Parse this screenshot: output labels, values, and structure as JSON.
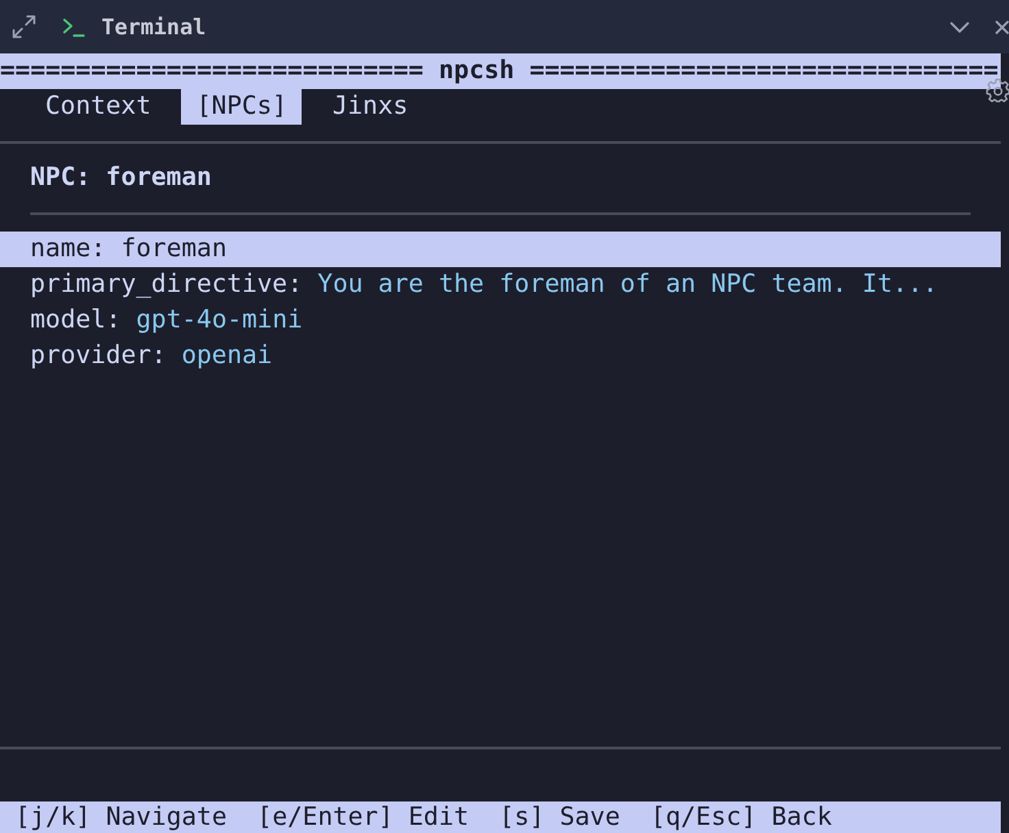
{
  "window": {
    "title": "Terminal"
  },
  "banner": {
    "text": "============================ npcsh ==============================="
  },
  "tabs": [
    {
      "label": "Context",
      "selected": false
    },
    {
      "label": "[NPCs]",
      "selected": true
    },
    {
      "label": "Jinxs",
      "selected": false
    }
  ],
  "panel": {
    "title": "NPC: foreman",
    "fields": [
      {
        "key": "name:",
        "value": "foreman",
        "selected": true
      },
      {
        "key": "primary_directive:",
        "value": "You are the foreman of an NPC team. It...",
        "selected": false
      },
      {
        "key": "model:",
        "value": "gpt-4o-mini",
        "selected": false
      },
      {
        "key": "provider:",
        "value": "openai",
        "selected": false
      }
    ]
  },
  "status_bar": {
    "text": "[j/k] Navigate  [e/Enter] Edit  [s] Save  [q/Esc] Back"
  }
}
